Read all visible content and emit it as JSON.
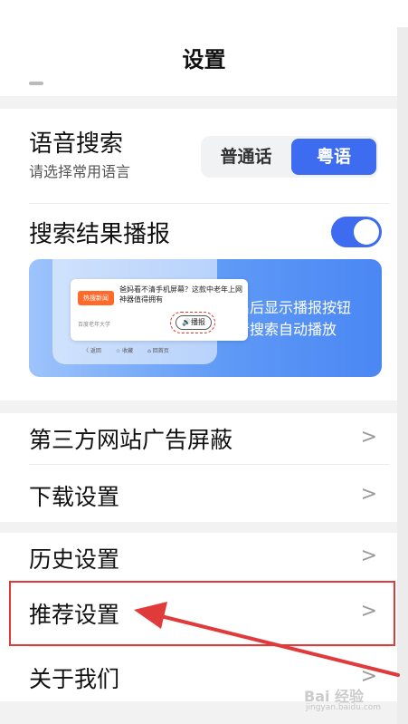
{
  "header": {
    "title": "设置"
  },
  "voice_search": {
    "label": "语音搜索",
    "sublabel": "请选择常用语言",
    "options": [
      "普通话",
      "粤语"
    ],
    "selected": "粤语"
  },
  "result_broadcast": {
    "label": "搜索结果播报",
    "enabled": true,
    "banner": {
      "card_tag": "热搜新闻",
      "card_title": "爸妈看不清手机屏幕？这款中老年上网神器值得拥有",
      "card_source": "百度老年大学",
      "play_label": "🔊播报",
      "nav_items": [
        "〈 返回",
        "☆ 收藏",
        "⌂ 回首页"
      ],
      "line1": "开启后显示播报按钮",
      "line2": "语音搜索自动播放"
    }
  },
  "menu": {
    "ad_block": "第三方网站广告屏蔽",
    "download": "下载设置",
    "history": "历史设置",
    "recommend": "推荐设置",
    "about": "关于我们"
  },
  "colors": {
    "accent": "#3d6cf0",
    "annotation": "#e03a3a"
  },
  "watermark": {
    "main": "Bai 经验",
    "sub": "jingyan.baidu.com"
  }
}
